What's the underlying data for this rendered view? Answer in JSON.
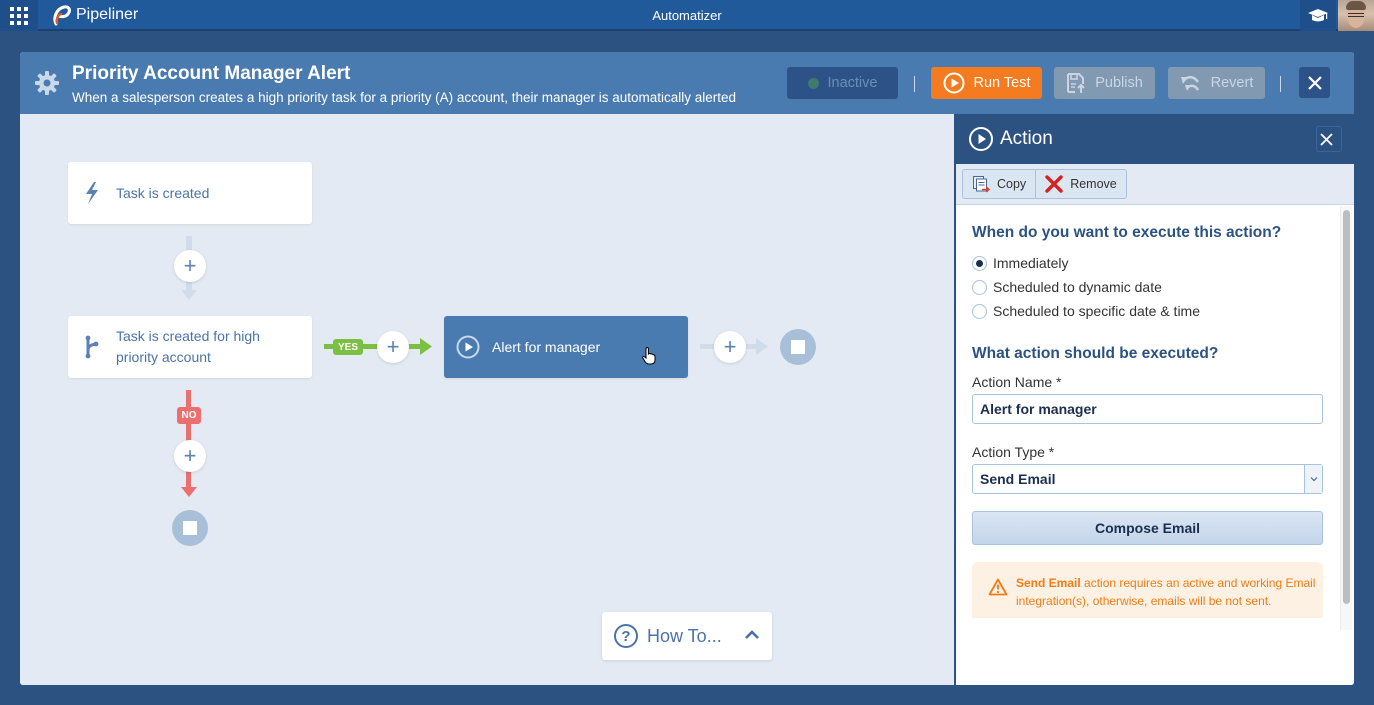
{
  "topbar": {
    "brand": "Pipeliner",
    "app_title": "Automatizer"
  },
  "workflow": {
    "title": "Priority Account Manager Alert",
    "description": "When a salesperson creates a high priority task for a priority (A) account, their manager is automatically alerted",
    "buttons": {
      "inactive": "Inactive",
      "run_test": "Run Test",
      "publish": "Publish",
      "revert": "Revert"
    },
    "colors": {
      "run_test": "#f47b20",
      "header": "#4a7bb0",
      "yes_branch": "#7cc043",
      "no_branch": "#ec6f6f"
    }
  },
  "canvas": {
    "trigger_node": {
      "label": "Task is created",
      "icon": "lightning-icon"
    },
    "condition_node": {
      "label": "Task is created for high priority account",
      "icon": "branch-icon"
    },
    "action_node": {
      "label": "Alert for manager",
      "icon": "play-circle-icon",
      "selected": true
    },
    "yes_label": "YES",
    "no_label": "NO",
    "howto_label": "How To..."
  },
  "panel": {
    "title": "Action",
    "toolbar": {
      "copy": "Copy",
      "remove": "Remove"
    },
    "when_question": "When do you want to execute this action?",
    "timing_options": [
      {
        "label": "Immediately",
        "selected": true
      },
      {
        "label": "Scheduled to dynamic date",
        "selected": false
      },
      {
        "label": "Scheduled to specific date & time",
        "selected": false
      }
    ],
    "what_question": "What action should be executed?",
    "action_name_label": "Action Name *",
    "action_name_value": "Alert for manager",
    "action_type_label": "Action Type *",
    "action_type_value": "Send Email",
    "compose_button": "Compose Email",
    "warning": {
      "bold": "Send Email",
      "text": " action requires an active and working Email integration(s), otherwise, emails will be not sent."
    }
  }
}
